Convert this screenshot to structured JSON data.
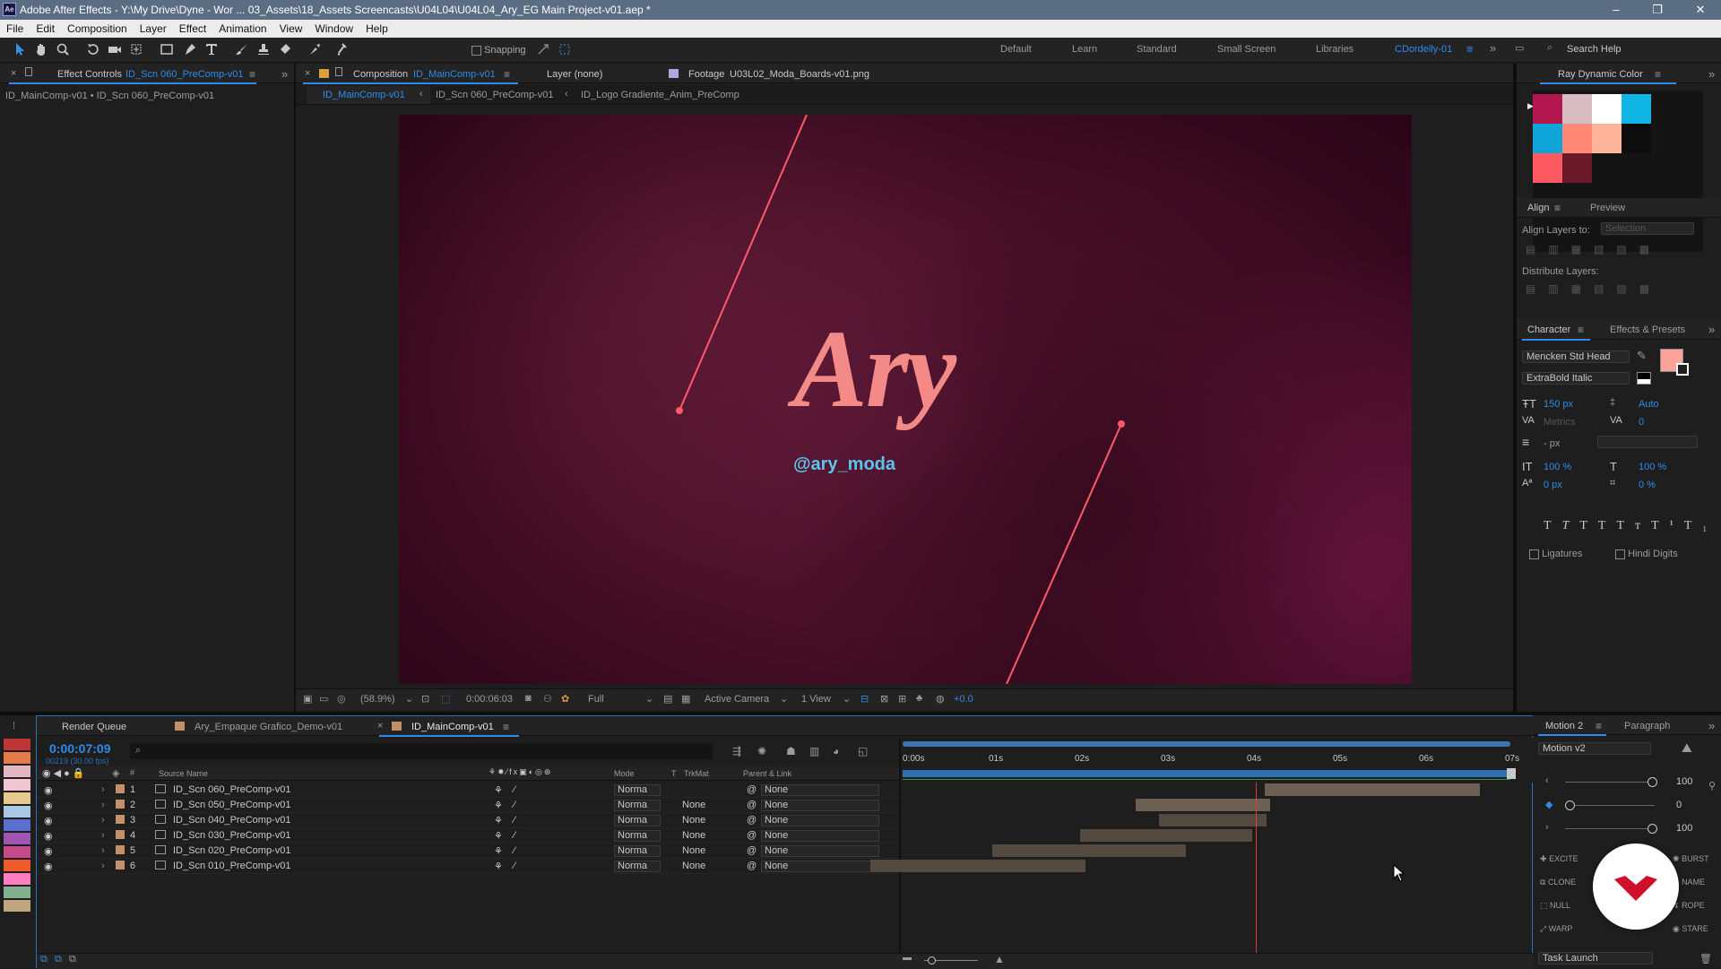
{
  "app": {
    "title": "Adobe After Effects - Y:\\My Drive\\Dyne - Wor ... 03_Assets\\18_Assets Screencasts\\U04L04\\U04L04_Ary_EG Main Project-v01.aep *",
    "logo": "Ae"
  },
  "menu": [
    "File",
    "Edit",
    "Composition",
    "Layer",
    "Effect",
    "Animation",
    "View",
    "Window",
    "Help"
  ],
  "toolbar": {
    "snapping": "Snapping",
    "workspaces": [
      "Default",
      "Learn",
      "Standard",
      "Small Screen",
      "Libraries",
      "CDordelly-01"
    ],
    "search": "Search Help"
  },
  "effect_controls": {
    "tab": "Effect Controls",
    "comp": "ID_Scn 060_PreComp-v01",
    "path": "ID_MainComp-v01 • ID_Scn 060_PreComp-v01"
  },
  "comp_panel": {
    "tab": "Composition",
    "comp": "ID_MainComp-v01",
    "layer_tab": "Layer (none)",
    "footage_tab": "Footage",
    "footage_name": "U03L02_Moda_Boards-v01.png",
    "breadcrumbs": [
      "ID_MainComp-v01",
      "ID_Scn 060_PreComp-v01",
      "ID_Logo Gradiente_Anim_PreComp"
    ]
  },
  "viewer": {
    "title_text": "Ary",
    "handle": "@ary_moda",
    "zoom": "(58.9%)",
    "timecode": "0:00:06:03",
    "resolution": "Full",
    "camera": "Active Camera",
    "views": "1 View",
    "exposure": "+0.0"
  },
  "ray_color": {
    "title": "Ray Dynamic Color",
    "swatches": [
      "#b2174f",
      "#d7bcc3",
      "#ffffff",
      "#0fb5e4",
      "#0fa5d8",
      "#ff8876",
      "#ffb59b",
      "#0d0d0d",
      "#ff5a62",
      "#6b1a2c"
    ]
  },
  "align": {
    "tab": "Align",
    "preview_tab": "Preview",
    "align_to": "Align Layers to:",
    "align_to_value": "Selection",
    "distribute": "Distribute Layers:"
  },
  "character": {
    "tab": "Character",
    "effects_tab": "Effects & Presets",
    "font": "Mencken Std Head",
    "style": "ExtraBold Italic",
    "size": "150 px",
    "leading": "Auto",
    "kerning": "Metrics",
    "tracking": "0",
    "line_unit": "- px",
    "vscale": "100 %",
    "hscale": "100 %",
    "baseline": "0 px",
    "tsume": "0 %",
    "ligatures": "Ligatures",
    "hindi": "Hindi Digits",
    "fill_color": "#f9a39a"
  },
  "timeline": {
    "tabs": [
      "Render Queue",
      "Ary_Empaque Grafico_Demo-v01",
      "ID_MainComp-v01"
    ],
    "timecode": "0:00:07:09",
    "frames": "00219 (30.00 fps)",
    "col_source": "Source Name",
    "col_mode": "Mode",
    "col_t": "T",
    "col_trk": "TrkMat",
    "col_parent": "Parent & Link",
    "ruler": [
      "0:00s",
      "01s",
      "02s",
      "03s",
      "04s",
      "05s",
      "06s",
      "07s"
    ],
    "layers": [
      {
        "num": "1",
        "name": "ID_Scn 060_PreComp-v01",
        "mode": "Norma",
        "trk": "",
        "parent": "None"
      },
      {
        "num": "2",
        "name": "ID_Scn 050_PreComp-v01",
        "mode": "Norma",
        "trk": "None",
        "parent": "None"
      },
      {
        "num": "3",
        "name": "ID_Scn 040_PreComp-v01",
        "mode": "Norma",
        "trk": "None",
        "parent": "None"
      },
      {
        "num": "4",
        "name": "ID_Scn 030_PreComp-v01",
        "mode": "Norma",
        "trk": "None",
        "parent": "None"
      },
      {
        "num": "5",
        "name": "ID_Scn 020_PreComp-v01",
        "mode": "Norma",
        "trk": "None",
        "parent": "None"
      },
      {
        "num": "6",
        "name": "ID_Scn 010_PreComp-v01",
        "mode": "Norma",
        "trk": "None",
        "parent": "None"
      }
    ]
  },
  "motion": {
    "tab": "Motion 2",
    "paragraph_tab": "Paragraph",
    "preset": "Motion v2",
    "v1": "100",
    "v2": "0",
    "v3": "100",
    "buttons_left": [
      "EXCITE",
      "CLONE",
      "NULL",
      "WARP"
    ],
    "buttons_right": [
      "BURST",
      "NAME",
      "ROPE",
      "STARE"
    ],
    "task": "Task Launch"
  },
  "label_colors": [
    "#c03535",
    "#e47a49",
    "#e3b8c4",
    "#f2c7d4",
    "#e7c98f",
    "#a6c8e5",
    "#5b6fcf",
    "#9e56b2",
    "#c44a8a",
    "#ef5a2b",
    "#ff7ec2",
    "#82b08e",
    "#c0a77f"
  ]
}
